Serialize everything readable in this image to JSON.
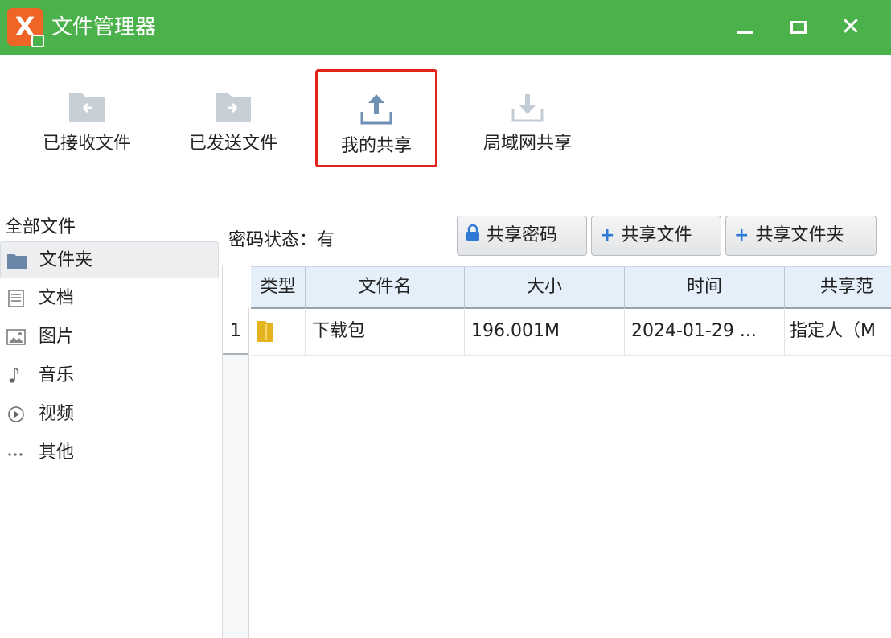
{
  "window": {
    "title": "文件管理器",
    "logo_text": "X",
    "close_glyph": "✕"
  },
  "toolbar": {
    "received_label": "已接收文件",
    "sent_label": "已发送文件",
    "myshare_label": "我的共享",
    "lan_label": "局域网共享"
  },
  "sidebar": {
    "title": "全部文件",
    "items": [
      {
        "label": "文件夹",
        "icon": "folder-icon"
      },
      {
        "label": "文档",
        "icon": "document-icon"
      },
      {
        "label": "图片",
        "icon": "image-icon"
      },
      {
        "label": "音乐",
        "icon": "music-icon"
      },
      {
        "label": "视频",
        "icon": "video-icon"
      },
      {
        "label": "其他",
        "icon": "more-icon"
      }
    ]
  },
  "content": {
    "password_status": "密码状态：有",
    "buttons": {
      "share_password": "共享密码",
      "share_file": "共享文件",
      "share_folder": "共享文件夹"
    },
    "table": {
      "headers": [
        "类型",
        "文件名",
        "大小",
        "时间",
        "共享范"
      ],
      "rows": [
        {
          "index": "1",
          "name": "下载包",
          "size": "196.001M",
          "time": "2024-01-29 ...",
          "scope": "指定人（M"
        }
      ]
    }
  },
  "colors": {
    "titlebar": "#4bb14a",
    "logo": "#f06426",
    "highlight_border": "#e2231a",
    "header_bg": "#e4effa"
  }
}
